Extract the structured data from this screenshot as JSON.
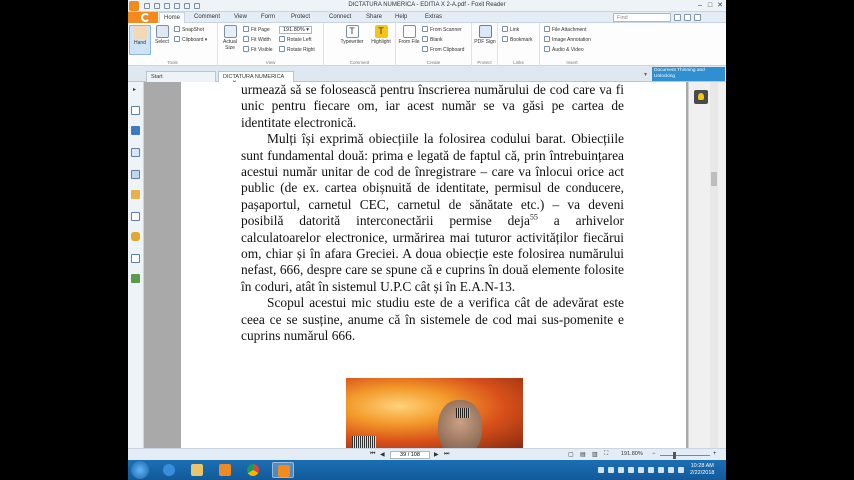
{
  "window": {
    "title": "DICTATURA NUMERICA - EDITIA X 2-A.pdf - Foxit Reader"
  },
  "menu": {
    "tabs": [
      "Home",
      "Comment",
      "View",
      "Form",
      "Protect",
      "Connect",
      "Share",
      "Help",
      "Extras"
    ],
    "find_placeholder": "Find"
  },
  "ribbon": {
    "tools": {
      "hand": "Hand",
      "select": "Select",
      "snapshot": "SnapShot",
      "clipboard": "Clipboard",
      "label": "Tools"
    },
    "view": {
      "actual_size": "Actual Size",
      "fit_page": "Fit Page",
      "fit_width": "Fit Width",
      "fit_visible": "Fit Visible",
      "zoom": "191.80%",
      "rotate_left": "Rotate Left",
      "rotate_right": "Rotate Right",
      "reflow": "Reflow",
      "label": "View"
    },
    "comment": {
      "typewriter": "Typewriter",
      "highlight": "Highlight",
      "label": "Comment"
    },
    "create": {
      "from_file": "From File",
      "from_scanner": "From Scanner",
      "blank": "Blank",
      "from_clipboard": "From Clipboard",
      "label": "Create"
    },
    "protect": {
      "pdf_sign": "PDF Sign",
      "label": "Protect"
    },
    "links": {
      "link": "Link",
      "bookmark": "Bookmark",
      "label": "Links"
    },
    "insert": {
      "file_attachment": "File Attachment",
      "image_annotation": "Image Annotation",
      "audio_video": "Audio & Video",
      "label": "Insert"
    }
  },
  "doc_tabs": {
    "start": "Start",
    "document": "DICTATURA NUMERICA ...",
    "tooltip": "Document Thinning and Unlocking"
  },
  "document": {
    "p1": "urmează să se folosească pentru înscrierea numărului de cod care va fi unic pentru fiecare om, iar acest număr se va găsi pe cartea de identitate electronică.",
    "p2_a": "Mulți își exprimă obiecțiile la folosirea codului barat. Obiecțiile sunt fundamental două: prima e legată de faptul că, prin întrebuințarea acestui număr unitar de cod de înregistrare – care va înlocui orice act public (de ex. cartea obișnuită de identitate, permisul de conducere, pașaportul, carnetul CEC, carnetul de sănătate etc.) – va deveni posibilă datorită interconectării permise deja",
    "footnote": "55",
    "p2_b": " a arhivelor calculatoarelor electronice, urmărirea mai tuturor activităților fiecărui om, chiar și în afara Greciei. A doua obiecție este folosirea numărului nefast, 666, despre care se spune că e cuprins în două elemente folosite în coduri, atât în sistemul U.P.C cât și în E.A.N-13.",
    "p3": "Scopul acestui mic studiu este de a verifica cât de adevărat este ceea ce se susține, anume că în sistemele de cod mai sus-pomenite e cuprins numărul 666."
  },
  "status": {
    "page": "39 / 108",
    "zoom": "191.80%"
  },
  "taskbar": {
    "time": "10:28 AM",
    "date": "2/22/2018"
  },
  "colors": {
    "accent": "#f28a1e",
    "ribbon_bg": "#fdfdfd",
    "taskbar": "#1b6fb5"
  }
}
